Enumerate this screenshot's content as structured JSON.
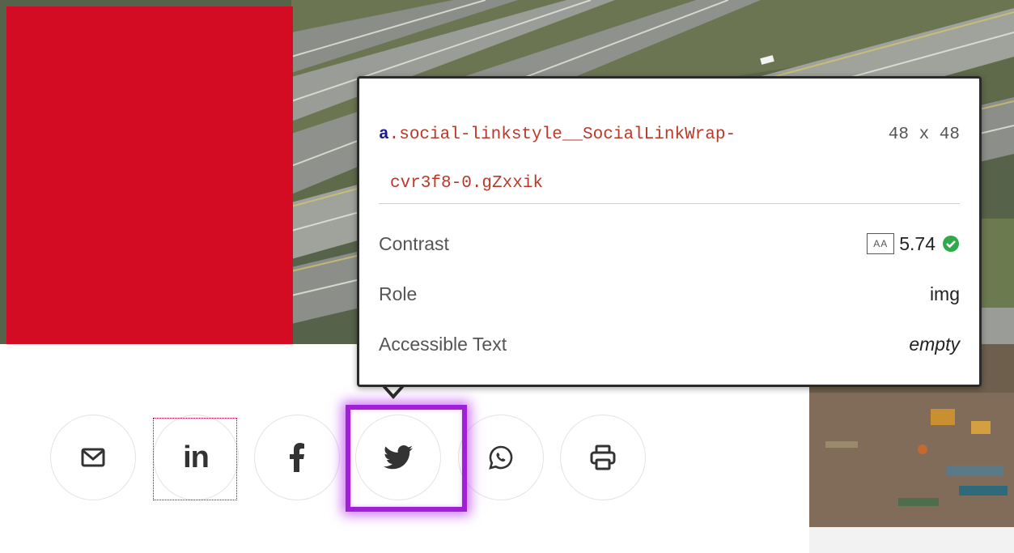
{
  "tooltip": {
    "selector_tag": "a",
    "selector_class_line1": ".social-linkstyle__SocialLinkWrap-",
    "selector_class_line2": "cvr3f8-0.gZxxik",
    "dimensions": "48 x 48",
    "properties": [
      {
        "label": "Contrast",
        "badge": "AA",
        "value": "5.74",
        "status": "pass"
      },
      {
        "label": "Role",
        "value": "img"
      },
      {
        "label": "Accessible Text",
        "value": "empty"
      }
    ]
  },
  "social_links": [
    {
      "icon": "mail-icon"
    },
    {
      "icon": "linkedin-icon",
      "text": "in"
    },
    {
      "icon": "facebook-icon"
    },
    {
      "icon": "twitter-icon",
      "highlighted": true
    },
    {
      "icon": "whatsapp-icon"
    },
    {
      "icon": "print-icon"
    }
  ],
  "colors": {
    "brand_red": "#d30c23",
    "inspect_highlight": "#a020d8",
    "selector_class": "#b8392a",
    "selector_tag": "#1c1c8c",
    "pass_green": "#2eaa4a",
    "icon": "#333333"
  }
}
